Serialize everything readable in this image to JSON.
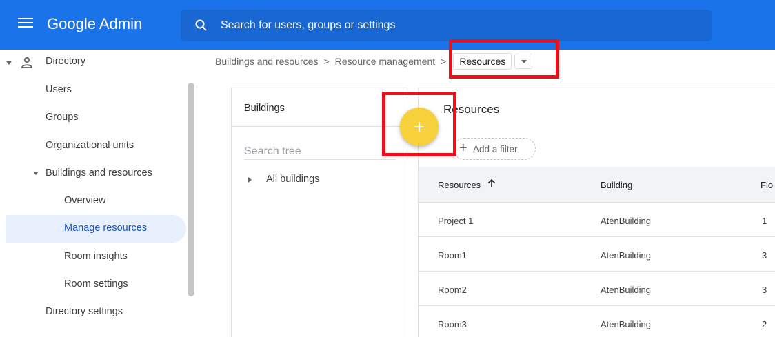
{
  "header": {
    "app_title": "Google Admin",
    "search_placeholder": "Search for users, groups or settings"
  },
  "sidebar": {
    "directory": "Directory",
    "users": "Users",
    "groups": "Groups",
    "org_units": "Organizational units",
    "buildings_resources": "Buildings and resources",
    "overview": "Overview",
    "manage_resources": "Manage resources",
    "room_insights": "Room insights",
    "room_settings": "Room settings",
    "directory_settings": "Directory settings"
  },
  "breadcrumb": {
    "item1": "Buildings and resources",
    "item2": "Resource management",
    "current": "Resources",
    "separator": ">"
  },
  "buildings_panel": {
    "title": "Buildings",
    "search_placeholder": "Search tree",
    "tree_item": "All buildings"
  },
  "resources_panel": {
    "title": "Resources",
    "filter_label": "Add a filter",
    "columns": [
      "Resources",
      "Building",
      "Flo"
    ],
    "rows": [
      {
        "name": "Project 1",
        "building": "AtenBuilding",
        "floor": "1"
      },
      {
        "name": "Room1",
        "building": "AtenBuilding",
        "floor": "3"
      },
      {
        "name": "Room2",
        "building": "AtenBuilding",
        "floor": "3"
      },
      {
        "name": "Room3",
        "building": "AtenBuilding",
        "floor": "2"
      }
    ]
  },
  "fab": {
    "label": "+"
  },
  "colors": {
    "header": "#1a73e8",
    "fab": "#f6d13c",
    "highlight": "#e8121b",
    "active_nav": "#e8f0fe"
  }
}
